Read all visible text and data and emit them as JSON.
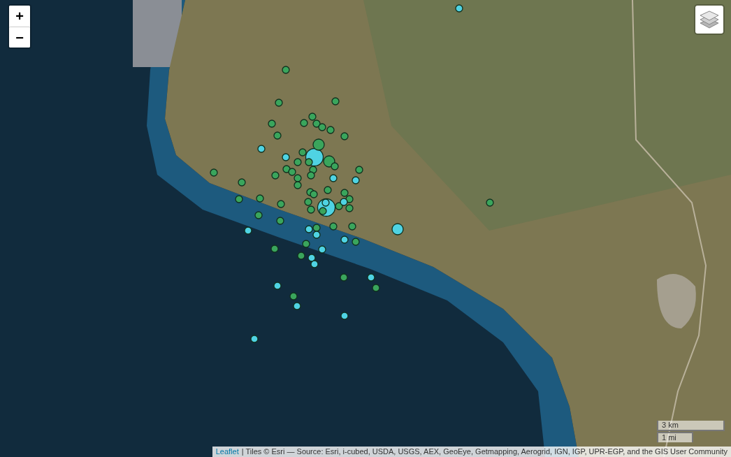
{
  "zoom_controls": [
    {
      "label": "+"
    },
    {
      "label": "−"
    }
  ],
  "markers": [
    {
      "color": "#3aa55c",
      "kind": "small"
    },
    {
      "color": "#3aa55c",
      "kind": "small"
    },
    {
      "color": "#3aa55c",
      "kind": "small"
    },
    {
      "color": "#3aa55c",
      "kind": "small"
    },
    {
      "color": "#3aa55c",
      "kind": "small"
    },
    {
      "color": "#3aa55c",
      "kind": "small"
    },
    {
      "color": "#3aa55c",
      "kind": "small"
    },
    {
      "color": "#3aa55c",
      "kind": "small"
    },
    {
      "color": "#3aa55c",
      "kind": "small"
    },
    {
      "color": "#3aa55c",
      "kind": "small"
    },
    {
      "color": "#3aa55c",
      "kind": "small"
    },
    {
      "color": "#3aa55c",
      "kind": "small"
    },
    {
      "color": "#3aa55c",
      "kind": "small"
    },
    {
      "color": "#3aa55c",
      "kind": "small"
    },
    {
      "color": "#3aa55c",
      "kind": "small"
    },
    {
      "color": "#3aa55c",
      "kind": "small"
    },
    {
      "color": "#3aa55c",
      "kind": "small"
    },
    {
      "color": "#3aa55c",
      "kind": "small"
    },
    {
      "color": "#3aa55c",
      "kind": "small"
    },
    {
      "color": "#3aa55c",
      "kind": "small"
    },
    {
      "color": "#3aa55c",
      "kind": "small"
    },
    {
      "color": "#3aa55c",
      "kind": "small"
    },
    {
      "color": "#3aa55c",
      "kind": "small"
    },
    {
      "color": "#3aa55c",
      "kind": "small"
    },
    {
      "color": "#3aa55c",
      "kind": "small"
    },
    {
      "color": "#3aa55c",
      "kind": "small"
    },
    {
      "color": "#3aa55c",
      "kind": "small"
    },
    {
      "color": "#3aa55c",
      "kind": "small"
    },
    {
      "color": "#3aa55c",
      "kind": "small"
    },
    {
      "color": "#3aa55c",
      "kind": "small"
    },
    {
      "color": "#3aa55c",
      "kind": "small"
    },
    {
      "color": "#3aa55c",
      "kind": "small"
    },
    {
      "color": "#3aa55c",
      "kind": "small"
    },
    {
      "color": "#3aa55c",
      "kind": "small"
    },
    {
      "color": "#3aa55c",
      "kind": "small"
    },
    {
      "color": "#3aa55c",
      "kind": "small"
    },
    {
      "color": "#3aa55c",
      "kind": "small"
    },
    {
      "color": "#3aa55c",
      "kind": "small"
    },
    {
      "color": "#3aa55c",
      "kind": "small"
    },
    {
      "color": "#3aa55c",
      "kind": "small"
    },
    {
      "color": "#3aa55c",
      "kind": "small"
    },
    {
      "color": "#3aa55c",
      "kind": "small"
    },
    {
      "color": "#3aa55c",
      "kind": "small"
    },
    {
      "color": "#3aa55c",
      "kind": "small"
    },
    {
      "color": "#3aa55c",
      "kind": "small"
    },
    {
      "color": "#3aa55c",
      "kind": "small"
    },
    {
      "color": "#3aa55c",
      "kind": "small"
    },
    {
      "color": "#3aa55c",
      "kind": "small"
    },
    {
      "color": "#3aa55c",
      "kind": "small"
    },
    {
      "color": "#3aa55c",
      "kind": "small"
    },
    {
      "color": "#3aa55c",
      "kind": "small"
    },
    {
      "color": "#3aa55c",
      "kind": "medium"
    },
    {
      "color": "#3aa55c",
      "kind": "medium"
    },
    {
      "color": "#4fd3e3",
      "kind": "small"
    },
    {
      "color": "#4fd3e3",
      "kind": "small"
    },
    {
      "color": "#4fd3e3",
      "kind": "small"
    },
    {
      "color": "#4fd3e3",
      "kind": "small"
    },
    {
      "color": "#4fd3e3",
      "kind": "small"
    },
    {
      "color": "#4fd3e3",
      "kind": "small"
    },
    {
      "color": "#4fd3e3",
      "kind": "small"
    },
    {
      "color": "#4fd3e3",
      "kind": "small"
    },
    {
      "color": "#4fd3e3",
      "kind": "small"
    },
    {
      "color": "#4fd3e3",
      "kind": "small"
    },
    {
      "color": "#4fd3e3",
      "kind": "small"
    },
    {
      "color": "#4fd3e3",
      "kind": "small"
    },
    {
      "color": "#4fd3e3",
      "kind": "small"
    },
    {
      "color": "#4fd3e3",
      "kind": "small"
    },
    {
      "color": "#4fd3e3",
      "kind": "small"
    },
    {
      "color": "#4fd3e3",
      "kind": "small"
    },
    {
      "color": "#4fd3e3",
      "kind": "small"
    },
    {
      "color": "#4fd3e3",
      "kind": "small"
    },
    {
      "color": "#4fd3e3",
      "kind": "small"
    },
    {
      "color": "#4fd3e3",
      "kind": "large"
    },
    {
      "color": "#4fd3e3",
      "kind": "large"
    },
    {
      "color": "#4fd3e3",
      "kind": "medium"
    }
  ],
  "scale": [
    "3 km",
    "1 mi"
  ],
  "attribution": {
    "link": "Leaflet",
    "text": "| Tiles © Esri — Source: Esri, i-cubed, USDA, USGS, AEX, GeoEye, Getmapping, Aerogrid, IGN, IGP, UPR-EGP, and the GIS User Community"
  }
}
